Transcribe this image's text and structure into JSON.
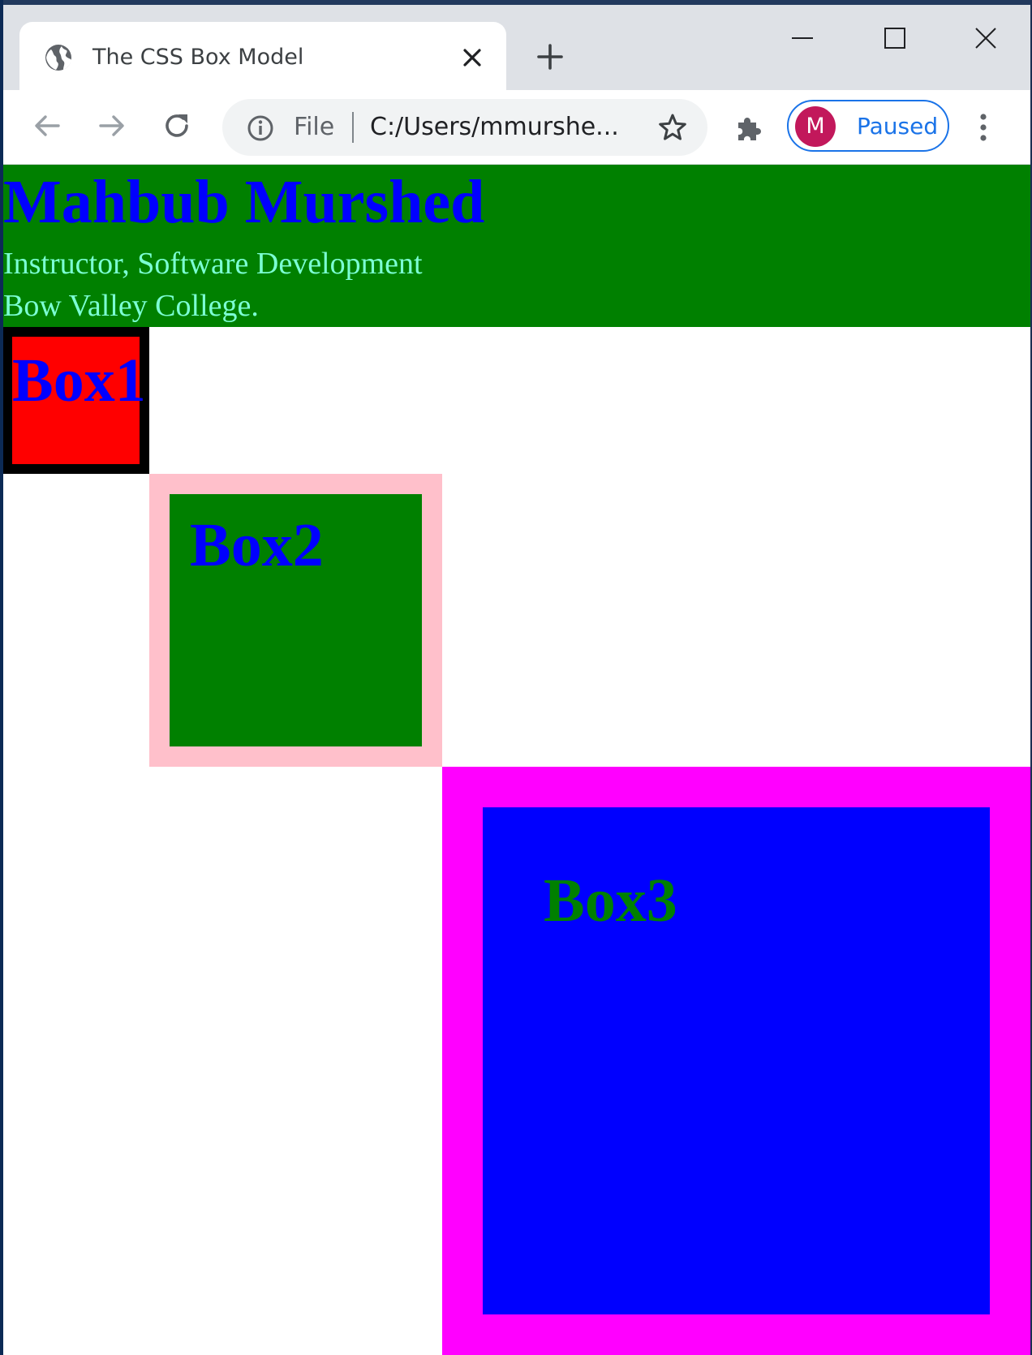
{
  "browser": {
    "tab": {
      "title": "The CSS Box Model",
      "icon": "globe-icon"
    },
    "window_controls": [
      "minimize-icon",
      "maximize-icon",
      "close-icon"
    ],
    "address_bar": {
      "scheme_label": "File",
      "url": "C:/Users/mmurshe..."
    },
    "profile": {
      "initial": "M",
      "status": "Paused",
      "avatar_color": "#c2185b",
      "accent": "#1a73e8"
    }
  },
  "page": {
    "header": {
      "name": "Mahbub Murshed",
      "title_line": "Instructor, Software Development",
      "org_line": "Bow Valley College.",
      "background": "#008000",
      "name_color": "#0000ff",
      "sub_color": "#7cffd4"
    },
    "boxes": [
      {
        "label": "Box1",
        "border_color": "#000000",
        "fill": "#ff0000",
        "text_color": "#0000ff"
      },
      {
        "label": "Box2",
        "border_color": "#ffc0cb",
        "fill": "#008000",
        "text_color": "#0000ff"
      },
      {
        "label": "Box3",
        "border_color": "#ff00ff",
        "fill": "#0000ff",
        "text_color": "#008000"
      }
    ]
  }
}
